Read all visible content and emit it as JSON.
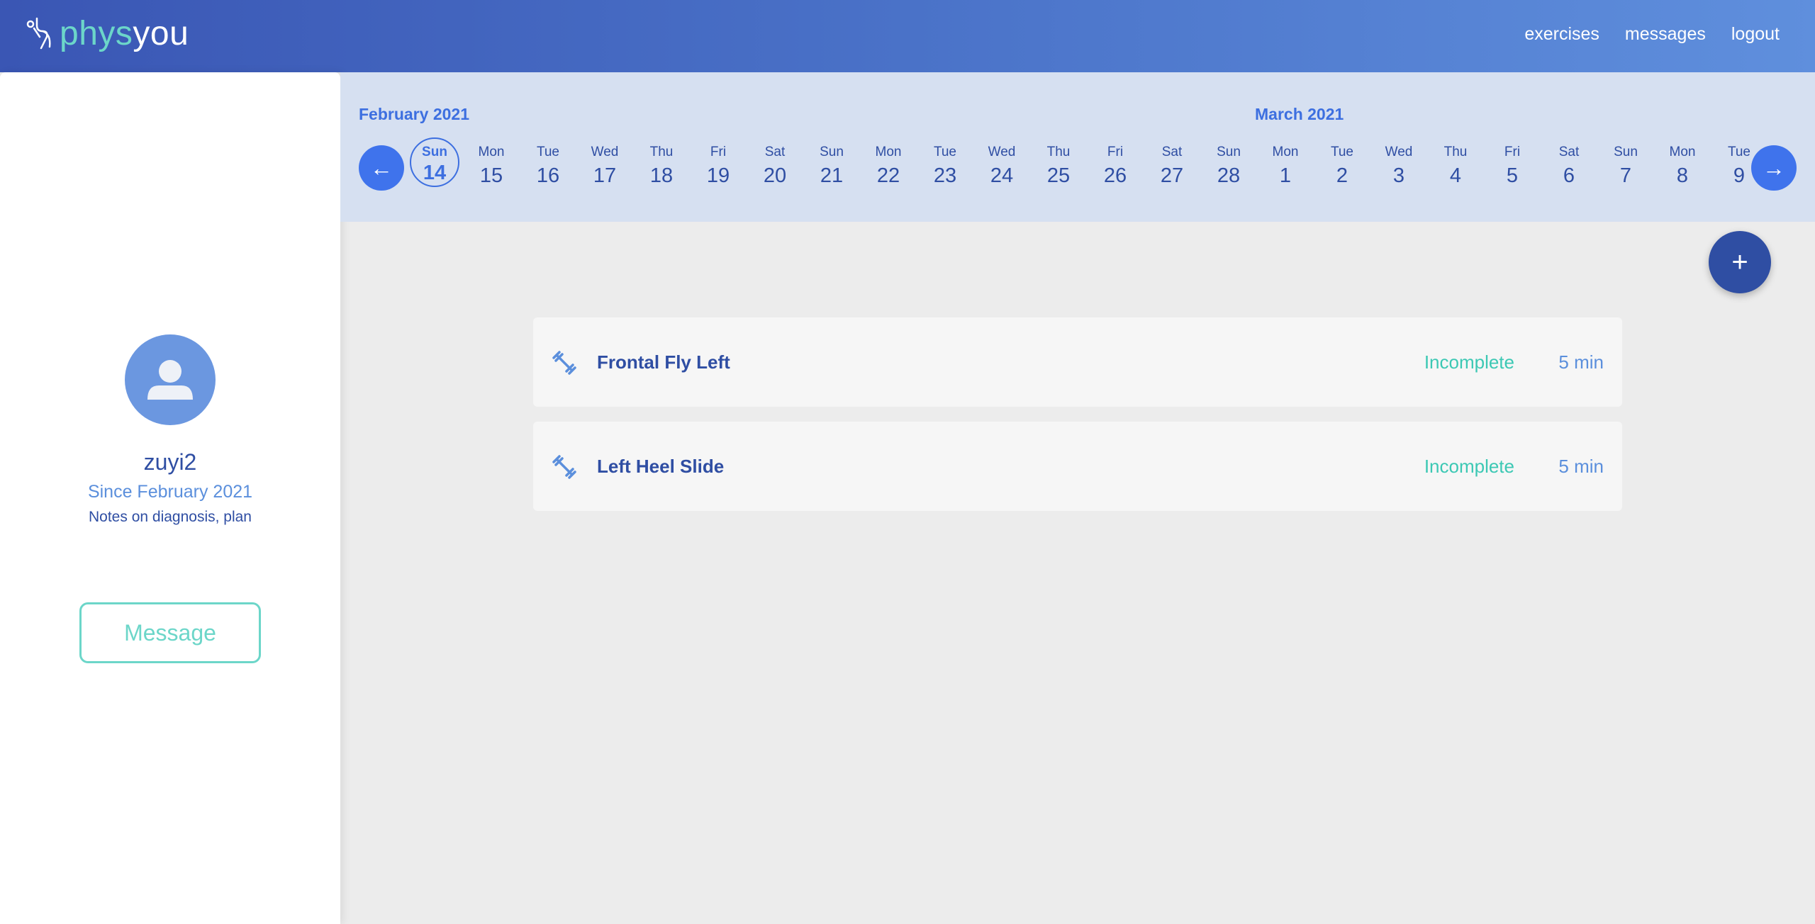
{
  "app": {
    "logo_part1": "phys",
    "logo_part2": "you"
  },
  "nav": {
    "exercises": "exercises",
    "messages": "messages",
    "logout": "logout"
  },
  "profile": {
    "username": "zuyi2",
    "since": "Since February 2021",
    "notes": "Notes on diagnosis, plan",
    "message_button": "Message"
  },
  "calendar": {
    "month_left": "February 2021",
    "month_right": "March 2021",
    "prev_arrow": "←",
    "next_arrow": "→",
    "days": [
      {
        "name": "Sun",
        "date": "14",
        "selected": true
      },
      {
        "name": "Mon",
        "date": "15"
      },
      {
        "name": "Tue",
        "date": "16"
      },
      {
        "name": "Wed",
        "date": "17"
      },
      {
        "name": "Thu",
        "date": "18"
      },
      {
        "name": "Fri",
        "date": "19"
      },
      {
        "name": "Sat",
        "date": "20"
      },
      {
        "name": "Sun",
        "date": "21"
      },
      {
        "name": "Mon",
        "date": "22"
      },
      {
        "name": "Tue",
        "date": "23"
      },
      {
        "name": "Wed",
        "date": "24"
      },
      {
        "name": "Thu",
        "date": "25"
      },
      {
        "name": "Fri",
        "date": "26"
      },
      {
        "name": "Sat",
        "date": "27"
      },
      {
        "name": "Sun",
        "date": "28"
      },
      {
        "name": "Mon",
        "date": "1"
      },
      {
        "name": "Tue",
        "date": "2"
      },
      {
        "name": "Wed",
        "date": "3"
      },
      {
        "name": "Thu",
        "date": "4"
      },
      {
        "name": "Fri",
        "date": "5"
      },
      {
        "name": "Sat",
        "date": "6"
      },
      {
        "name": "Sun",
        "date": "7"
      },
      {
        "name": "Mon",
        "date": "8"
      },
      {
        "name": "Tue",
        "date": "9"
      }
    ]
  },
  "add_button": "+",
  "exercises": [
    {
      "name": "Frontal Fly Left",
      "status": "Incomplete",
      "duration": "5 min",
      "icon": "dumbbell-icon"
    },
    {
      "name": "Left Heel Slide",
      "status": "Incomplete",
      "duration": "5 min",
      "icon": "dumbbell-icon"
    }
  ],
  "colors": {
    "primary": "#2f4ea3",
    "accent": "#3f73ec",
    "teal": "#6cd6c9",
    "status_incomplete": "#3cc8b4"
  }
}
